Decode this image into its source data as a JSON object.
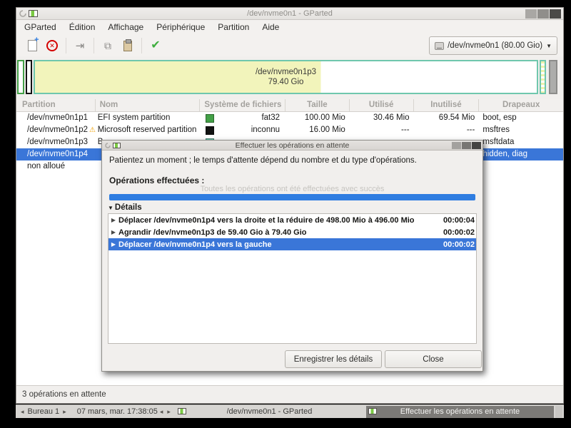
{
  "window": {
    "title": "/dev/nvme0n1 - GParted",
    "menu": [
      "GParted",
      "Édition",
      "Affichage",
      "Périphérique",
      "Partition",
      "Aide"
    ],
    "toolbar_icons": [
      "new-partition-icon",
      "delete-partition-icon",
      "resize-move-icon",
      "copy-icon",
      "paste-icon",
      "apply-icon"
    ],
    "device_selector": "/dev/nvme0n1 (80.00 Gio)",
    "status": "3 opérations en attente"
  },
  "visual_bar": {
    "label_line1": "/dev/nvme0n1p3",
    "label_line2": "79.40 Gio"
  },
  "table": {
    "headers": [
      "Partition",
      "Nom",
      "Système de fichiers",
      "Taille",
      "Utilisé",
      "Inutilisé",
      "Drapeaux"
    ],
    "rows": [
      {
        "partition": "/dev/nvme0n1p1",
        "warning": "",
        "name": "EFI system partition",
        "fs": "fat32",
        "size": "100.00 Mio",
        "used": "30.46 Mio",
        "unused": "69.54 Mio",
        "flags": "boot, esp"
      },
      {
        "partition": "/dev/nvme0n1p2",
        "warning": "⚠",
        "name": "Microsoft reserved partition",
        "fs": "inconnu",
        "size": "16.00 Mio",
        "used": "---",
        "unused": "---",
        "flags": "msftres"
      },
      {
        "partition": "/dev/nvme0n1p3",
        "warning": "",
        "name": "B",
        "fs": "",
        "size": "",
        "used": "",
        "unused": "",
        "flags": "msftdata"
      },
      {
        "partition": "/dev/nvme0n1p4",
        "warning": "",
        "name": "",
        "fs": "",
        "size": "",
        "used": "",
        "unused": "",
        "flags": "hidden, diag"
      },
      {
        "partition": "non alloué",
        "warning": "",
        "name": "",
        "fs": "",
        "size": "",
        "used": "",
        "unused": "",
        "flags": ""
      }
    ]
  },
  "dialog": {
    "title": "Effectuer les opérations en attente",
    "message": "Patientez un moment ; le temps d'attente dépend du nombre et du type d'opérations.",
    "operations_label": "Opérations effectuées :",
    "progress_text": "Toutes les opérations ont été effectuées avec succès",
    "details_label": "Détails",
    "operations": [
      {
        "text": "Déplacer /dev/nvme0n1p4 vers la droite et la réduire de 498.00 Mio à 496.00 Mio",
        "time": "00:00:04"
      },
      {
        "text": "Agrandir /dev/nvme0n1p3 de 59.40 Gio à 79.40 Gio",
        "time": "00:00:02"
      },
      {
        "text": "Déplacer /dev/nvme0n1p4 vers la gauche",
        "time": "00:00:02"
      }
    ],
    "save_button": "Enregistrer les détails",
    "close_button": "Close"
  },
  "taskbar": {
    "workspace": "Bureau 1",
    "clock": "07 mars, mar. 17:38:05",
    "tasks": [
      {
        "label": "/dev/nvme0n1 - GParted",
        "active": false
      },
      {
        "label": "Effectuer les opérations en attente",
        "active": true
      }
    ]
  },
  "colors": {
    "selection_blue": "#3a76d8",
    "progress_blue": "#2f7de1",
    "fs_fat32_green": "#43a047",
    "fs_unknown_black": "#121212",
    "fs_ntfs_teal": "#6fc7ad",
    "used_space_yellow": "#f2f4bb",
    "unallocated_gray": "#adadab",
    "warning_orange": "#f0a000"
  }
}
